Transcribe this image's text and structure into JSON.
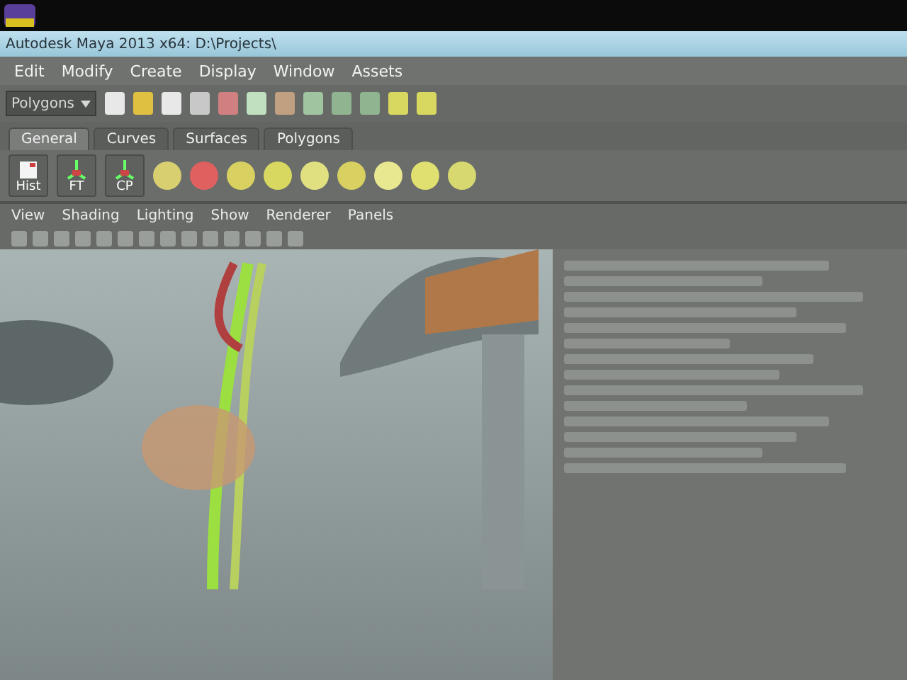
{
  "window": {
    "title": "Autodesk Maya 2013 x64: D:\\Projects\\"
  },
  "menu_bar": {
    "items": [
      "Edit",
      "Modify",
      "Create",
      "Display",
      "Window",
      "Assets"
    ]
  },
  "status_line": {
    "mode": "Polygons"
  },
  "shelf": {
    "tabs": [
      {
        "label": "General",
        "selected": true
      },
      {
        "label": "Curves",
        "selected": false
      },
      {
        "label": "Surfaces",
        "selected": false
      },
      {
        "label": "Polygons",
        "selected": false
      }
    ],
    "buttons": [
      {
        "label": "Hist",
        "kind": "doc"
      },
      {
        "label": "FT",
        "kind": "axes"
      },
      {
        "label": "CP",
        "kind": "axes"
      }
    ]
  },
  "panel_menu": {
    "items": [
      "View",
      "Shading",
      "Lighting",
      "Show",
      "Renderer",
      "Panels"
    ]
  }
}
